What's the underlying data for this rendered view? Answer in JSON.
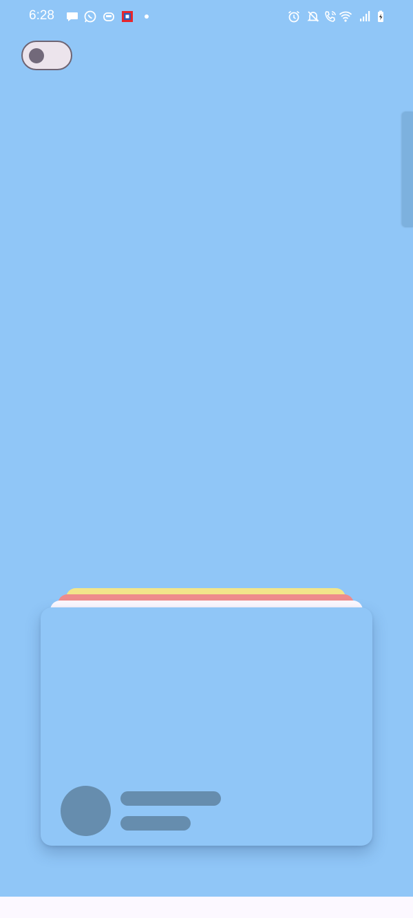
{
  "status_bar": {
    "time": "6:28",
    "left_icons": [
      "chat-bubble-icon",
      "whatsapp-icon",
      "cloud-box-icon",
      "app-square-icon",
      "dot-icon"
    ],
    "right_icons": [
      "alarm-icon",
      "silent-bell-icon",
      "wifi-calling-icon",
      "wifi-icon",
      "signal-icon",
      "battery-charging-icon"
    ]
  },
  "toggle": {
    "state": "off"
  },
  "colors": {
    "background": "#90C6F7",
    "stack_yellow": "#F2E58A",
    "stack_red": "#EE8C8C",
    "stack_white": "#FCF8FF",
    "placeholder": "#668DAE",
    "toggle_track": "#ECE4EC",
    "toggle_knob": "#72697A"
  }
}
